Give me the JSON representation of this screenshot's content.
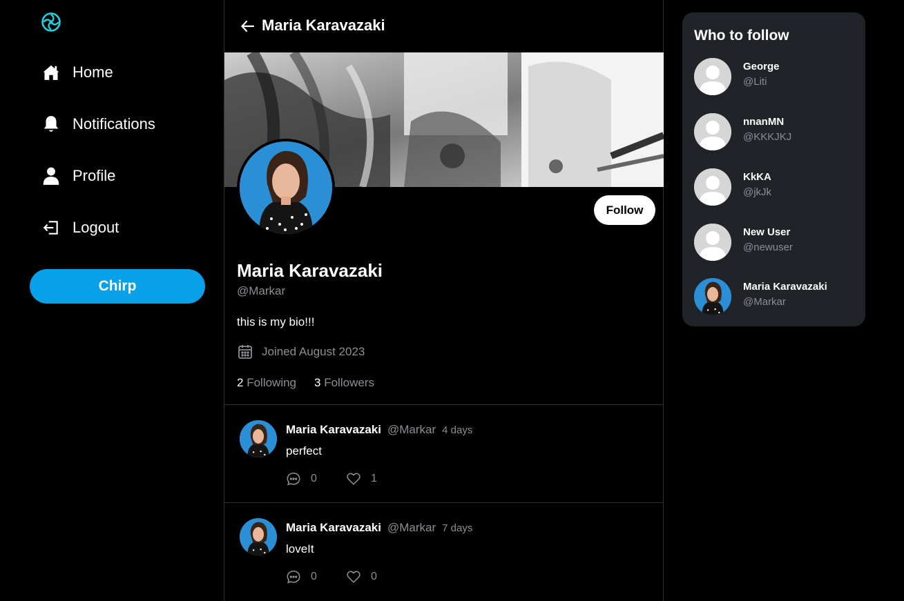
{
  "sidebar": {
    "logo_icon": "chirp-logo-icon",
    "items": [
      {
        "label": "Home",
        "icon": "home-icon"
      },
      {
        "label": "Notifications",
        "icon": "bell-icon"
      },
      {
        "label": "Profile",
        "icon": "user-icon"
      },
      {
        "label": "Logout",
        "icon": "logout-icon"
      }
    ],
    "chirp_label": "Chirp"
  },
  "header": {
    "title": "Maria Karavazaki"
  },
  "profile": {
    "follow_label": "Follow",
    "name": "Maria Karavazaki",
    "handle": "@Markar",
    "bio": "this is my bio!!!",
    "joined": "Joined August 2023",
    "following_count": "2",
    "following_label": "Following",
    "followers_count": "3",
    "followers_label": "Followers"
  },
  "posts": [
    {
      "author": "Maria Karavazaki",
      "handle": "@Markar",
      "time": "4 days",
      "text": "perfect",
      "comments": "0",
      "likes": "1"
    },
    {
      "author": "Maria Karavazaki",
      "handle": "@Markar",
      "time": "7 days",
      "text": "loveIt",
      "comments": "0",
      "likes": "0"
    }
  ],
  "who_to_follow": {
    "title": "Who to follow",
    "users": [
      {
        "name": "George",
        "handle": "@Liti",
        "avatar": "default"
      },
      {
        "name": "nnanMN",
        "handle": "@KKKJKJ",
        "avatar": "default"
      },
      {
        "name": "KkKA",
        "handle": "@jkJk",
        "avatar": "default"
      },
      {
        "name": "New User",
        "handle": "@newuser",
        "avatar": "default"
      },
      {
        "name": "Maria Karavazaki",
        "handle": "@Markar",
        "avatar": "photo"
      }
    ]
  },
  "colors": {
    "accent": "#08a0e9",
    "background": "#000000",
    "panel": "#202327",
    "muted_text": "#8b8f93",
    "logo": "#1fd1e0"
  }
}
